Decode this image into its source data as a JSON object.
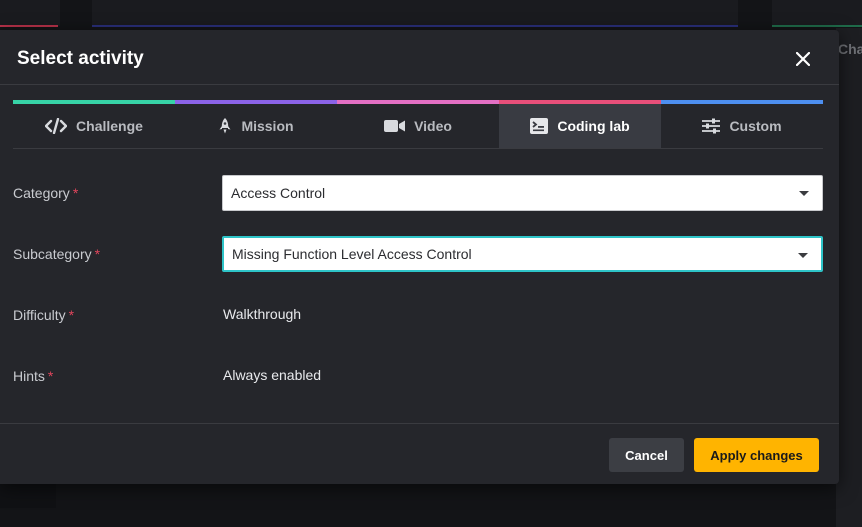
{
  "background": {
    "right_panel_text": "Challe"
  },
  "modal": {
    "title": "Select activity",
    "close_icon": "close-icon"
  },
  "tabs": [
    {
      "label": "Challenge",
      "icon": "code-icon",
      "color": "#37d3a7",
      "active": false
    },
    {
      "label": "Mission",
      "icon": "rocket-icon",
      "color": "#8b63e8",
      "active": false
    },
    {
      "label": "Video",
      "icon": "video-camera-icon",
      "color": "#e36fc4",
      "active": false
    },
    {
      "label": "Coding lab",
      "icon": "coding-lab-icon",
      "color": "#e84f7a",
      "active": true
    },
    {
      "label": "Custom",
      "icon": "sliders-icon",
      "color": "#4d8ff0",
      "active": false
    }
  ],
  "form": {
    "category": {
      "label": "Category",
      "required": "*",
      "value": "Access Control"
    },
    "subcategory": {
      "label": "Subcategory",
      "required": "*",
      "value": "Missing Function Level Access Control"
    },
    "difficulty": {
      "label": "Difficulty",
      "required": "*",
      "value": "Walkthrough"
    },
    "hints": {
      "label": "Hints",
      "required": "*",
      "value": "Always enabled"
    }
  },
  "footer": {
    "cancel_label": "Cancel",
    "apply_label": "Apply changes"
  },
  "colors": {
    "accent_yellow": "#ffb400",
    "focus_teal": "#2ec4c8",
    "required_red": "#e0455c"
  }
}
